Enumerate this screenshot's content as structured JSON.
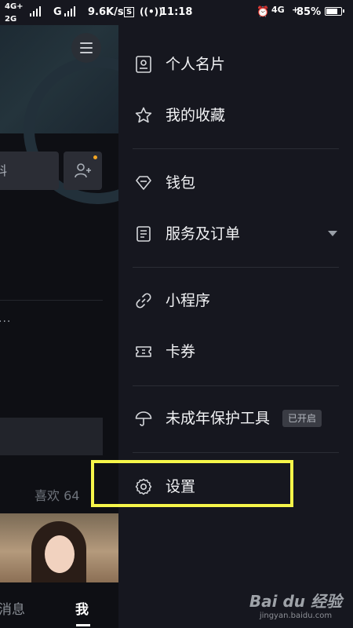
{
  "status_bar": {
    "net_left_top": "4G+",
    "net_left_bottom": "2G",
    "carrier_g": "G",
    "speed": "9.6K/s",
    "sim": "S",
    "time": "11:18",
    "net_right": "4G",
    "battery_percent": "85%",
    "battery_level": 0.85
  },
  "profile_page": {
    "edit_partial": "料",
    "ellipsis": "...",
    "likes": "喜欢 64",
    "nav_messages": "消息",
    "nav_me": "我"
  },
  "drawer": {
    "items": [
      {
        "label": "个人名片",
        "icon": "id-card-icon"
      },
      {
        "label": "我的收藏",
        "icon": "star-icon"
      },
      {
        "label": "钱包",
        "icon": "wallet-diamond-icon"
      },
      {
        "label": "服务及订单",
        "icon": "order-list-icon"
      },
      {
        "label": "小程序",
        "icon": "link-icon"
      },
      {
        "label": "卡券",
        "icon": "coupon-icon"
      },
      {
        "label": "未成年保护工具",
        "icon": "umbrella-icon",
        "badge": "已开启"
      },
      {
        "label": "设置",
        "icon": "gear-icon"
      }
    ]
  },
  "watermark": {
    "top": "Bai du 经验",
    "bottom": "jingyan.baidu.com"
  },
  "colors": {
    "background": "#16171f",
    "highlight": "#f6f64a",
    "badge_bg": "#3a3c44",
    "notify_dot": "#f5a623"
  }
}
